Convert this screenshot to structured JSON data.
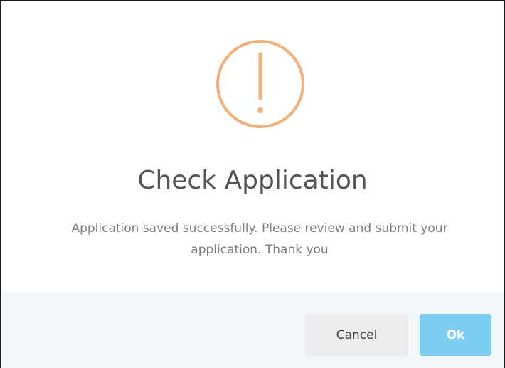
{
  "dialog": {
    "icon": "exclamation-circle-icon",
    "title": "Check Application",
    "message": "Application saved successfully. Please review and submit your application. Thank you"
  },
  "buttons": {
    "cancel_label": "Cancel",
    "ok_label": "Ok"
  },
  "colors": {
    "warning_accent": "#f2b179",
    "confirm_button": "#7dcdf3",
    "cancel_button": "#ececec",
    "footer_background": "#f4f7fa"
  }
}
